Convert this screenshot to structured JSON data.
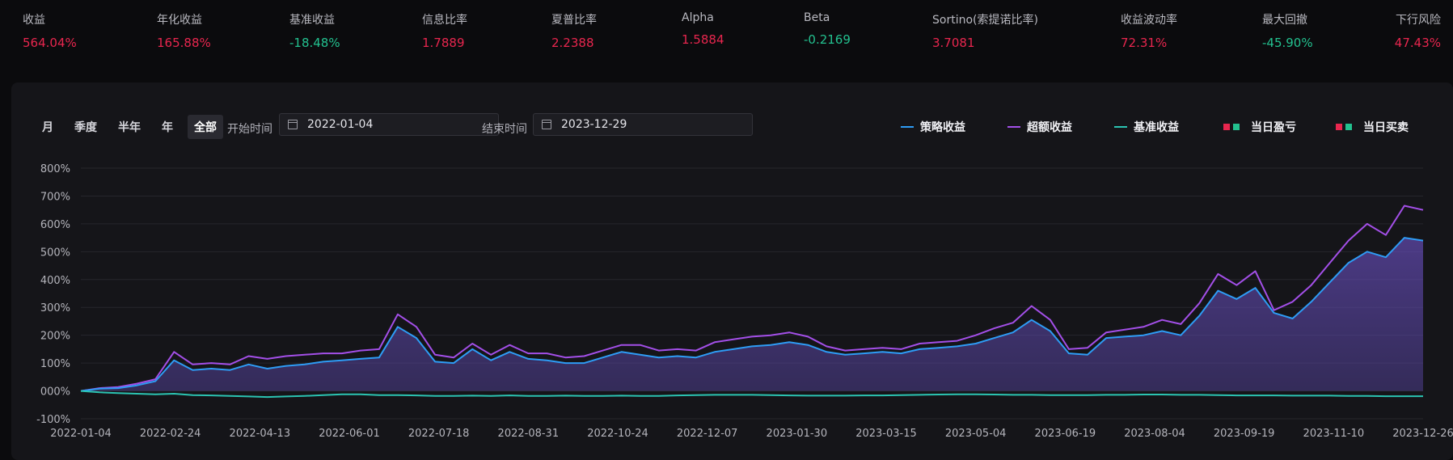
{
  "stats": [
    {
      "label": "收益",
      "value": "564.04%",
      "tone": "pos"
    },
    {
      "label": "年化收益",
      "value": "165.88%",
      "tone": "pos"
    },
    {
      "label": "基准收益",
      "value": "-18.48%",
      "tone": "neg"
    },
    {
      "label": "信息比率",
      "value": "1.7889",
      "tone": "pos"
    },
    {
      "label": "夏普比率",
      "value": "2.2388",
      "tone": "pos"
    },
    {
      "label": "Alpha",
      "value": "1.5884",
      "tone": "pos"
    },
    {
      "label": "Beta",
      "value": "-0.2169",
      "tone": "neg"
    },
    {
      "label": "Sortino(索提诺比率)",
      "value": "3.7081",
      "tone": "pos"
    },
    {
      "label": "收益波动率",
      "value": "72.31%",
      "tone": "pos"
    },
    {
      "label": "最大回撤",
      "value": "-45.90%",
      "tone": "neg"
    },
    {
      "label": "下行风险",
      "value": "47.43%",
      "tone": "pos"
    }
  ],
  "controls": {
    "periods": [
      "月",
      "季度",
      "半年",
      "年",
      "全部"
    ],
    "active_period": "全部",
    "start_label": "开始时间",
    "start_value": "2022-01-04",
    "end_label": "结束时间",
    "end_value": "2023-12-29"
  },
  "legend": [
    {
      "label": "策略收益",
      "kind": "line",
      "color": "#2e9cf5"
    },
    {
      "label": "超额收益",
      "kind": "line",
      "color": "#a34fe8"
    },
    {
      "label": "基准收益",
      "kind": "line",
      "color": "#2bc3b2"
    },
    {
      "label": "当日盈亏",
      "kind": "squares",
      "colors": [
        "#e8264e",
        "#23c18f"
      ]
    },
    {
      "label": "当日买卖",
      "kind": "squares",
      "colors": [
        "#e8264e",
        "#23c18f"
      ]
    }
  ],
  "chart_data": {
    "type": "line",
    "ylim": [
      -100,
      800
    ],
    "yticks": [
      -100,
      0,
      100,
      200,
      300,
      400,
      500,
      600,
      700,
      800
    ],
    "ytick_labels": [
      "-100%",
      "000%",
      "100%",
      "200%",
      "300%",
      "400%",
      "500%",
      "600%",
      "700%",
      "800%"
    ],
    "xtick_labels": [
      "2022-01-04",
      "2022-02-24",
      "2022-04-13",
      "2022-06-01",
      "2022-07-18",
      "2022-08-31",
      "2022-10-24",
      "2022-12-07",
      "2023-01-30",
      "2023-03-15",
      "2023-05-04",
      "2023-06-19",
      "2023-08-04",
      "2023-09-19",
      "2023-11-10",
      "2023-12-26"
    ],
    "grid": true,
    "legend_position": "top-right",
    "series": [
      {
        "name": "策略收益",
        "color": "#2e9cf5",
        "values": [
          0,
          8,
          10,
          20,
          35,
          110,
          75,
          80,
          75,
          95,
          80,
          90,
          95,
          105,
          110,
          115,
          120,
          230,
          190,
          105,
          100,
          150,
          110,
          140,
          115,
          110,
          100,
          100,
          120,
          140,
          130,
          120,
          125,
          120,
          140,
          150,
          160,
          165,
          175,
          165,
          140,
          130,
          135,
          140,
          135,
          150,
          155,
          160,
          170,
          190,
          210,
          255,
          215,
          135,
          130,
          190,
          195,
          200,
          215,
          200,
          270,
          360,
          330,
          370,
          280,
          260,
          320,
          390,
          460,
          500,
          480,
          550,
          540
        ]
      },
      {
        "name": "超额收益",
        "color": "#a34fe8",
        "values": [
          0,
          10,
          14,
          26,
          42,
          140,
          95,
          100,
          95,
          125,
          115,
          125,
          130,
          135,
          135,
          145,
          150,
          275,
          230,
          130,
          120,
          170,
          130,
          165,
          135,
          135,
          120,
          125,
          145,
          165,
          165,
          145,
          150,
          145,
          175,
          185,
          195,
          200,
          210,
          195,
          160,
          145,
          150,
          155,
          150,
          170,
          175,
          180,
          200,
          225,
          245,
          305,
          255,
          150,
          155,
          210,
          220,
          230,
          255,
          240,
          315,
          420,
          380,
          430,
          290,
          320,
          380,
          460,
          540,
          600,
          560,
          665,
          650
        ]
      },
      {
        "name": "基准收益",
        "color": "#2bc3b2",
        "values": [
          0,
          -5,
          -8,
          -10,
          -12,
          -10,
          -15,
          -16,
          -18,
          -20,
          -22,
          -20,
          -18,
          -15,
          -12,
          -12,
          -15,
          -15,
          -16,
          -18,
          -18,
          -17,
          -18,
          -16,
          -18,
          -18,
          -17,
          -18,
          -18,
          -17,
          -18,
          -18,
          -16,
          -15,
          -14,
          -14,
          -14,
          -15,
          -16,
          -17,
          -17,
          -17,
          -16,
          -16,
          -15,
          -14,
          -13,
          -12,
          -12,
          -13,
          -14,
          -14,
          -15,
          -15,
          -15,
          -14,
          -14,
          -13,
          -13,
          -14,
          -14,
          -15,
          -16,
          -16,
          -16,
          -17,
          -17,
          -17,
          -18,
          -18,
          -19,
          -19,
          -19
        ]
      }
    ]
  }
}
